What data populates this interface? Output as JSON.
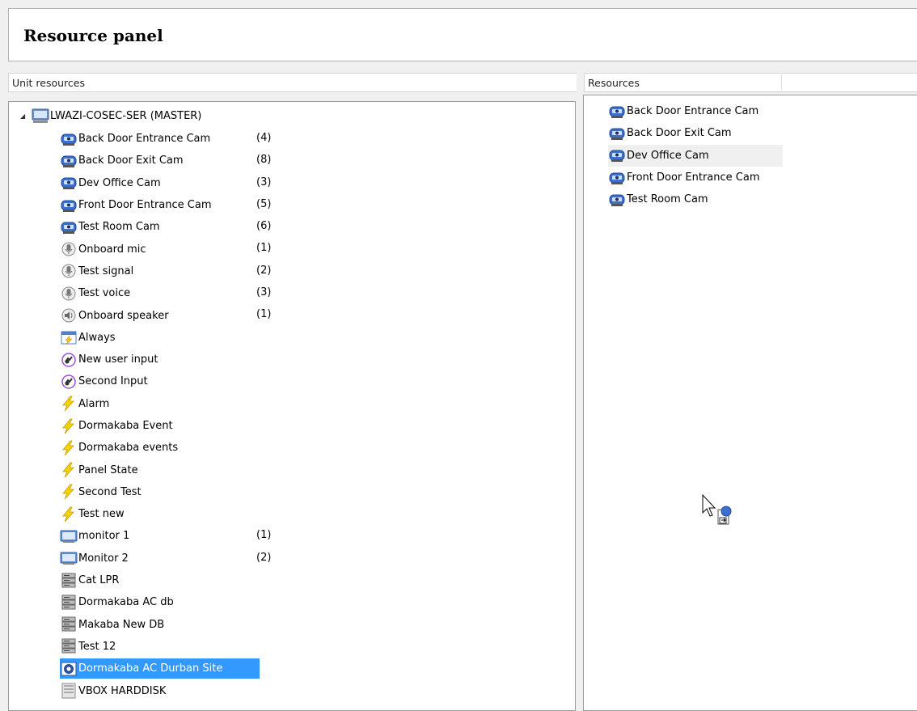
{
  "panel": {
    "title": "Resource panel"
  },
  "left": {
    "header": "Unit resources",
    "root": {
      "label": "LWAZI-COSEC-SER (MASTER)",
      "icon": "server-computer-icon"
    },
    "items": [
      {
        "label": "Back Door Entrance Cam",
        "count": "(4)",
        "icon": "camera-icon"
      },
      {
        "label": "Back Door Exit Cam",
        "count": "(8)",
        "icon": "camera-icon"
      },
      {
        "label": "Dev Office Cam",
        "count": "(3)",
        "icon": "camera-icon"
      },
      {
        "label": "Front Door Entrance Cam",
        "count": "(5)",
        "icon": "camera-icon"
      },
      {
        "label": "Test Room Cam",
        "count": "(6)",
        "icon": "camera-icon"
      },
      {
        "label": "Onboard mic",
        "count": "(1)",
        "icon": "microphone-icon"
      },
      {
        "label": "Test signal",
        "count": "(2)",
        "icon": "microphone-icon"
      },
      {
        "label": "Test voice",
        "count": "(3)",
        "icon": "microphone-icon"
      },
      {
        "label": "Onboard speaker",
        "count": "(1)",
        "icon": "speaker-icon"
      },
      {
        "label": "Always",
        "count": "",
        "icon": "schedule-calendar-icon"
      },
      {
        "label": "New user input",
        "count": "",
        "icon": "user-input-icon"
      },
      {
        "label": "Second Input",
        "count": "",
        "icon": "user-input-icon"
      },
      {
        "label": "Alarm",
        "count": "",
        "icon": "event-lightning-icon"
      },
      {
        "label": "Dormakaba  Event",
        "count": "",
        "icon": "event-lightning-icon"
      },
      {
        "label": "Dormakaba events",
        "count": "",
        "icon": "event-lightning-icon"
      },
      {
        "label": "Panel State",
        "count": "",
        "icon": "event-lightning-icon"
      },
      {
        "label": "Second Test",
        "count": "",
        "icon": "event-lightning-icon"
      },
      {
        "label": "Test new",
        "count": "",
        "icon": "event-lightning-icon"
      },
      {
        "label": "monitor 1",
        "count": "(1)",
        "icon": "monitor-icon"
      },
      {
        "label": "Monitor 2",
        "count": "(2)",
        "icon": "monitor-icon"
      },
      {
        "label": "Cat LPR",
        "count": "",
        "icon": "database-server-icon"
      },
      {
        "label": "Dormakaba AC db",
        "count": "",
        "icon": "database-server-icon"
      },
      {
        "label": "Makaba New DB",
        "count": "",
        "icon": "database-server-icon"
      },
      {
        "label": "Test 12",
        "count": "",
        "icon": "database-server-icon"
      },
      {
        "label": "Dormakaba AC Durban Site",
        "count": "",
        "icon": "access-control-site-icon",
        "selected": true
      },
      {
        "label": "VBOX HARDDISK",
        "count": "",
        "icon": "hard-disk-icon"
      }
    ]
  },
  "right": {
    "header": "Resources",
    "items": [
      {
        "label": "Back Door Entrance Cam",
        "icon": "camera-icon"
      },
      {
        "label": "Back Door Exit Cam",
        "icon": "camera-icon"
      },
      {
        "label": "Dev Office Cam",
        "icon": "camera-icon",
        "highlighted": true
      },
      {
        "label": "Front Door Entrance Cam",
        "icon": "camera-icon"
      },
      {
        "label": "Test Room Cam",
        "icon": "camera-icon"
      }
    ]
  },
  "colors": {
    "selection": "#3399ff",
    "camera_blue": "#3b6fd0",
    "event_yellow": "#f2c200",
    "input_purple": "#9b4fd0"
  }
}
